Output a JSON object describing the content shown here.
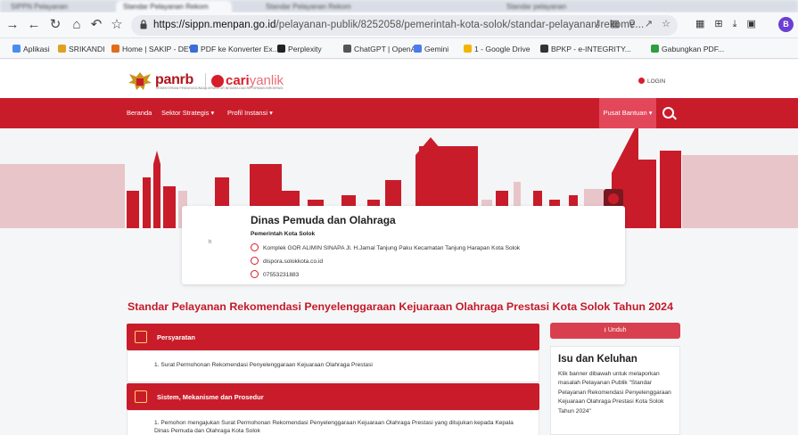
{
  "browser": {
    "tabs": [
      "SIPPN Pelayanan",
      "Standar Pelayanan Rekom",
      "Standar Pelayanan Rekom",
      "Standar pelayanan"
    ],
    "url_host": "https://sippn.menpan.go.id",
    "url_path": "/pelayanan-publik/8252058/pemerintah-kota-solok/standar-pelayanan-rekome...",
    "profile_initial": "B",
    "bookmarks": [
      {
        "label": "Aplikasi",
        "color": "#4a8cf0"
      },
      {
        "label": "SRIKANDI",
        "color": "#e0a021"
      },
      {
        "label": "Home | SAKIP - DEV",
        "color": "#e36b1c"
      },
      {
        "label": "PDF ke Konverter Ex...",
        "color": "#3a6fd8"
      },
      {
        "label": "Perplexity",
        "color": "#222222"
      },
      {
        "label": "ChatGPT | OpenAI",
        "color": "#555555"
      },
      {
        "label": "Gemini",
        "color": "#4b7bec"
      },
      {
        "label": "1 - Google Drive",
        "color": "#f4b400"
      },
      {
        "label": "BPKP - e-INTEGRITY...",
        "color": "#333333"
      },
      {
        "label": "Gabungkan PDF...",
        "color": "#2e9e3e"
      }
    ]
  },
  "header": {
    "panrb": "panrb",
    "panrb_sub": "KEMENTERIAN PENDAYAGUNAAN APARATUR NEGARA DAN REFORMASI BIROKRASI",
    "cari": "cari",
    "yanlik": "yanlik",
    "login": "LOGIN"
  },
  "nav": {
    "items": [
      "Beranda",
      "Sektor Strategis ▾",
      "Profil Instansi ▾"
    ],
    "help": "Pusat Bantuan ▾"
  },
  "profile": {
    "logo_alt": "h",
    "name": "Dinas Pemuda dan Olahraga",
    "parent": "Pemerintah Kota Solok",
    "address": "Komplek GOR ALIMIN SINAPA Jl. H.Jamal Tanjung Paku Kecamatan Tanjung Harapan Kota Solok",
    "website": "dispora.solokkota.co.id",
    "phone": "07553231883"
  },
  "page_title": "Standar Pelayanan Rekomendasi Penyelenggaraan Kejuaraan Olahraga Prestasi Kota Solok Tahun 2024",
  "sections": {
    "persyaratan": {
      "title": "Persyaratan",
      "items": [
        "1. Surat Permohonan Rekomendasi Penyelenggaraan Kejuaraan Olahraga Prestasi"
      ]
    },
    "sistem": {
      "title": "Sistem, Mekanisme dan Prosedur",
      "items": [
        "1. Pemohon mengajukan Surat Permohonan Rekomendasi Penyelenggaraan Kejuaraan Olahraga Prestasi yang ditujukan kepada Kepala Dinas Pemuda dan Olahraga Kota Solok"
      ]
    }
  },
  "sidebar": {
    "download": "⭳  Unduh",
    "isu_title": "Isu dan Keluhan",
    "isu_desc": "Klik banner dibawah untuk melaporkan masalah Pelayanan Publik \"Standar Pelayanan Rekomendasi Penyelenggaraan Kejuaraan Olahraga Prestasi Kota Solok Tahun 2024\""
  },
  "colors": {
    "brand_red": "#c91c2a",
    "accent_red": "#d71d2a"
  }
}
